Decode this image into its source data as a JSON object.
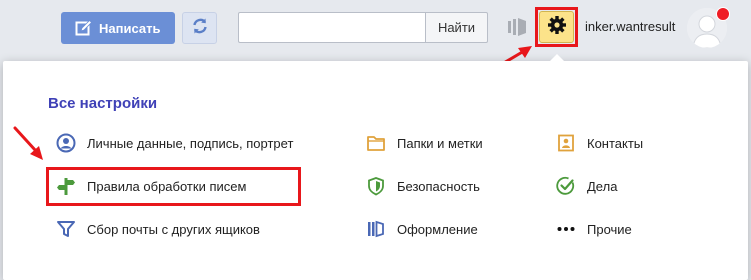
{
  "header": {
    "compose_label": "Написать",
    "search_button_label": "Найти",
    "search_value": "",
    "search_placeholder": "",
    "username": "inker.wantresult"
  },
  "icons": {
    "compose": "pencil-edit-icon",
    "refresh": "refresh-icon",
    "compact": "compact-mode-icon",
    "settings": "gear-icon",
    "avatar": "user-silhouette-icon"
  },
  "colors": {
    "compose_bg": "#6b8fd6",
    "settings_bg": "#fce38a",
    "highlight_red": "#e8171b",
    "title_blue": "#3f41b7"
  },
  "settings_panel": {
    "title": "Все настройки",
    "items": [
      {
        "label": "Личные данные, подпись, портрет",
        "icon": "person-circle-icon"
      },
      {
        "label": "Правила обработки писем",
        "icon": "signpost-icon"
      },
      {
        "label": "Сбор почты с других ящиков",
        "icon": "funnel-icon"
      },
      {
        "label": "Папки и метки",
        "icon": "folder-icon"
      },
      {
        "label": "Безопасность",
        "icon": "shield-icon"
      },
      {
        "label": "Оформление",
        "icon": "theme-book-icon"
      },
      {
        "label": "Контакты",
        "icon": "contact-card-icon"
      },
      {
        "label": "Дела",
        "icon": "checkmark-circle-icon"
      },
      {
        "label": "Прочие",
        "icon": "more-dots-icon"
      }
    ]
  }
}
